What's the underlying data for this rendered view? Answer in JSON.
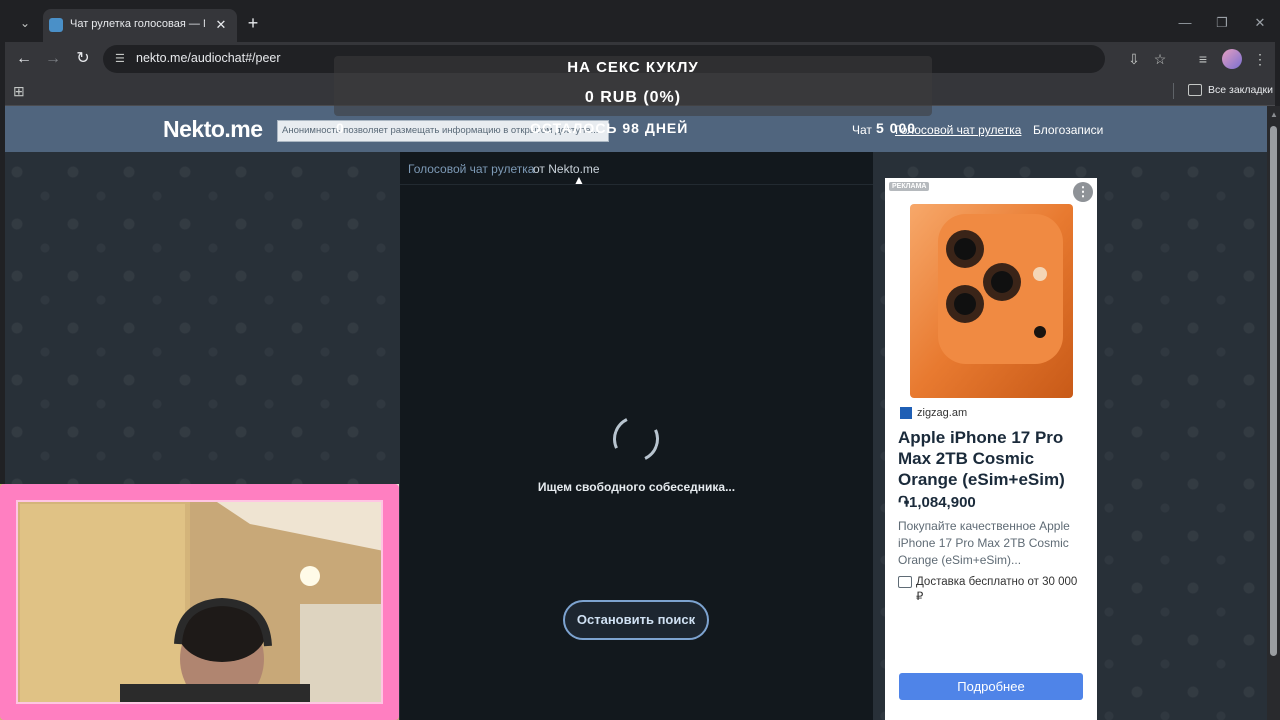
{
  "browser": {
    "tab_title": "Чат рулетка голосовая — Nekto.me",
    "url": "nekto.me/audiochat#/peer",
    "all_bookmarks": "Все закладки"
  },
  "site": {
    "logo": "Nekto.me",
    "notice": "Анонимность позволяет размещать информацию в открытом доступе...",
    "nav": {
      "chat": "Чат",
      "roulette": "Голосовой чат рулетка",
      "blog": "Блогозаписи"
    },
    "breadcrumb": {
      "link": "Голосовой чат рулетка",
      "from": "от Nekto.me"
    },
    "status": "Ищем свободного собеседника...",
    "stop_button": "Остановить поиск"
  },
  "ad": {
    "badge": "РЕКЛАМА",
    "source": "zigzag.am",
    "title": "Apple iPhone 17 Pro Max 2TB Cosmic Orange (eSim+eSim)",
    "price": "֏1,084,900",
    "description": "Покупайте качественное Apple iPhone 17 Pro Max 2TB Cosmic Orange (eSim+eSim)...",
    "delivery": "Доставка бесплатно от 30 000 ₽",
    "button": "Подробнее"
  },
  "stream_overlay": {
    "goal": "НА СЕКС КУКЛУ",
    "amount": "0 RUB (0%)",
    "zero": "0",
    "days_left": "ОСТАЛОСЬ 98 ДНЕЙ",
    "count": "5 000"
  },
  "icons": {
    "back": "back-arrow-icon",
    "forward": "forward-arrow-icon",
    "reload": "reload-icon"
  }
}
